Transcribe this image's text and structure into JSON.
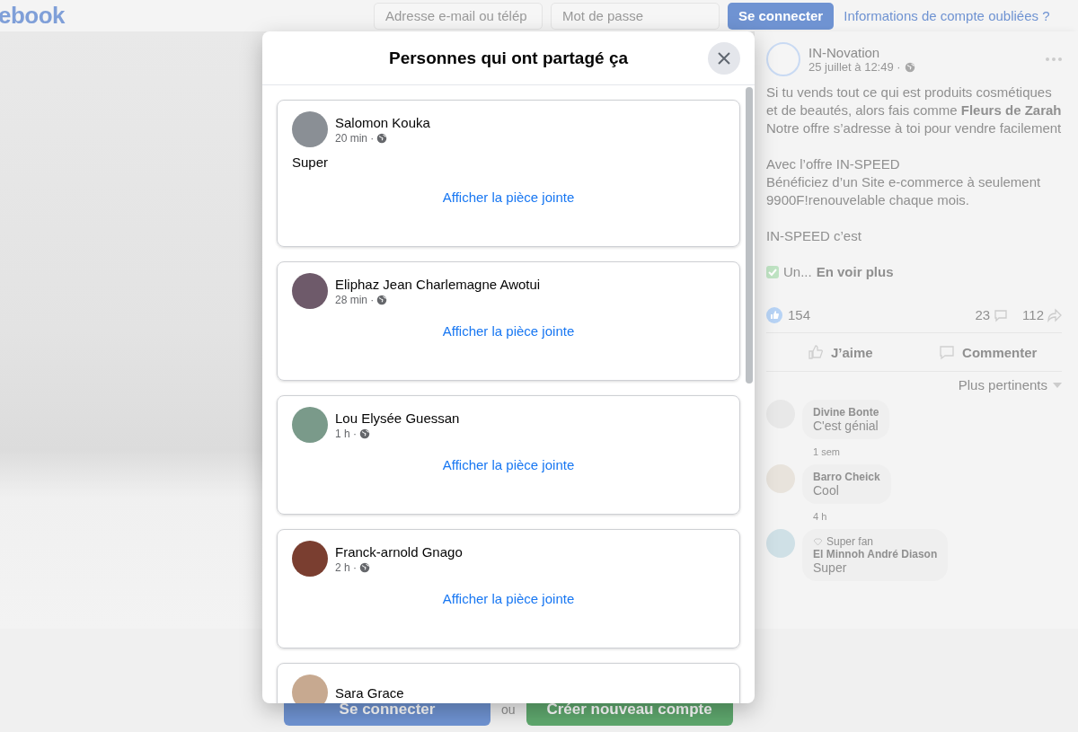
{
  "header": {
    "logo": "ebook",
    "email_field": {
      "placeholder": "Adresse e-mail ou télép"
    },
    "password_field": {
      "placeholder": "Mot de passe"
    },
    "login_button": "Se connecter",
    "forgot_link": "Informations de compte oubliées ?"
  },
  "post": {
    "author": "IN-Novation",
    "date": "25 juillet à 12:49 ·",
    "paragraphs": [
      [
        "Si tu vends tout ce qui est produits cosmétiques et de beautés, alors fais comme **Fleurs de Zarah**",
        "Notre offre s’adresse à toi pour vendre facilement"
      ],
      [
        "Avec l’offre IN-SPEED",
        "Bénéficiez d’un Site e-commerce à seulement 9900F!renouvelable chaque mois."
      ],
      [
        "IN-SPEED c’est"
      ]
    ],
    "truncated": "Un...",
    "see_more": "En voir plus",
    "reactions": "154",
    "comments_count": "23",
    "shares_count": "112",
    "actions": [
      "J’aime",
      "Commenter"
    ],
    "sort": "Plus pertinents",
    "comments": [
      {
        "name": "Divine Bonte",
        "text": "C'est génial",
        "time": "1 sem"
      },
      {
        "name": "Barro Cheick",
        "text": "Cool",
        "time": "4 h"
      },
      {
        "badge": "Super fan",
        "name": "El Minnoh André Diason",
        "text": "Super"
      }
    ]
  },
  "modal": {
    "title": "Personnes qui ont partagé ça",
    "shares": [
      {
        "name": "Salomon Kouka",
        "time": "20 min ·",
        "message": "Super",
        "link": "Afficher la pièce jointe"
      },
      {
        "name": "Eliphaz Jean Charlemagne Awotui",
        "time": "28 min ·",
        "link": "Afficher la pièce jointe"
      },
      {
        "name": "Lou Elysée Guessan",
        "time": "1 h ·",
        "link": "Afficher la pièce jointe"
      },
      {
        "name": "Franck-arnold Gnago",
        "time": "2 h ·",
        "link": "Afficher la pièce jointe"
      },
      {
        "name": "Sara Grace"
      }
    ]
  },
  "footer": {
    "login_button": "Se connecter",
    "separator": "ou",
    "signup_button": "Créer nouveau compte"
  }
}
